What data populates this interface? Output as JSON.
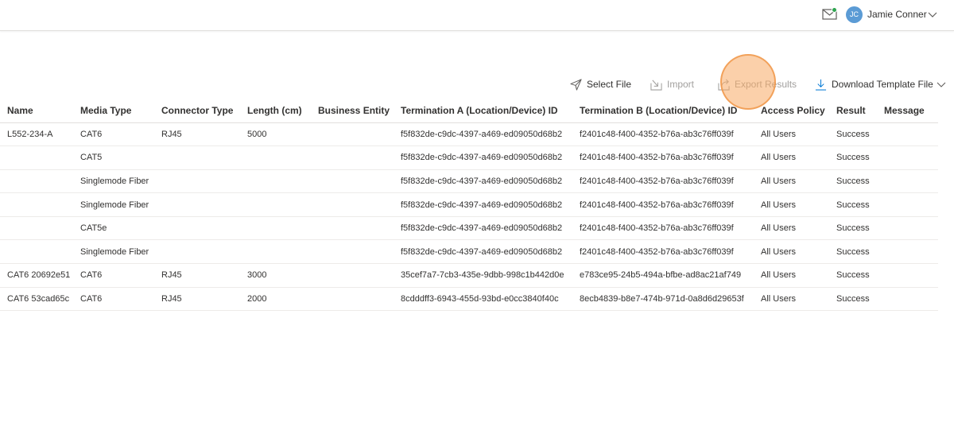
{
  "header": {
    "user_initials": "JC",
    "user_name": "Jamie Conner",
    "icons": [
      "mail-icon",
      "chevron-down-icon"
    ],
    "notification_color": "#2ea44f"
  },
  "toolbar": {
    "select_file": "Select File",
    "import": "Import",
    "export_results": "Export Results",
    "download_template": "Download Template File"
  },
  "table": {
    "columns": [
      "Name",
      "Media Type",
      "Connector Type",
      "Length (cm)",
      "Business Entity",
      "Termination A (Location/Device) ID",
      "Termination B (Location/Device) ID",
      "Access Policy",
      "Result",
      "Message"
    ],
    "rows": [
      [
        "L552-234-A",
        "CAT6",
        "RJ45",
        "5000",
        "",
        "f5f832de-c9dc-4397-a469-ed09050d68b2",
        "f2401c48-f400-4352-b76a-ab3c76ff039f",
        "All Users",
        "Success",
        ""
      ],
      [
        "",
        "CAT5",
        "",
        "",
        "",
        "f5f832de-c9dc-4397-a469-ed09050d68b2",
        "f2401c48-f400-4352-b76a-ab3c76ff039f",
        "All Users",
        "Success",
        ""
      ],
      [
        "",
        "Singlemode Fiber",
        "",
        "",
        "",
        "f5f832de-c9dc-4397-a469-ed09050d68b2",
        "f2401c48-f400-4352-b76a-ab3c76ff039f",
        "All Users",
        "Success",
        ""
      ],
      [
        "",
        "Singlemode Fiber",
        "",
        "",
        "",
        "f5f832de-c9dc-4397-a469-ed09050d68b2",
        "f2401c48-f400-4352-b76a-ab3c76ff039f",
        "All Users",
        "Success",
        ""
      ],
      [
        "",
        "CAT5e",
        "",
        "",
        "",
        "f5f832de-c9dc-4397-a469-ed09050d68b2",
        "f2401c48-f400-4352-b76a-ab3c76ff039f",
        "All Users",
        "Success",
        ""
      ],
      [
        "",
        "Singlemode Fiber",
        "",
        "",
        "",
        "f5f832de-c9dc-4397-a469-ed09050d68b2",
        "f2401c48-f400-4352-b76a-ab3c76ff039f",
        "All Users",
        "Success",
        ""
      ],
      [
        "CAT6 20692e51",
        "CAT6",
        "RJ45",
        "3000",
        "",
        "35cef7a7-7cb3-435e-9dbb-998c1b442d0e",
        "e783ce95-24b5-494a-bfbe-ad8ac21af749",
        "All Users",
        "Success",
        ""
      ],
      [
        "CAT6 53cad65c",
        "CAT6",
        "RJ45",
        "2000",
        "",
        "8cdddff3-6943-455d-93bd-e0cc3840f40c",
        "8ecb4839-b8e7-474b-971d-0a8d6d29653f",
        "All Users",
        "Success",
        ""
      ]
    ]
  }
}
